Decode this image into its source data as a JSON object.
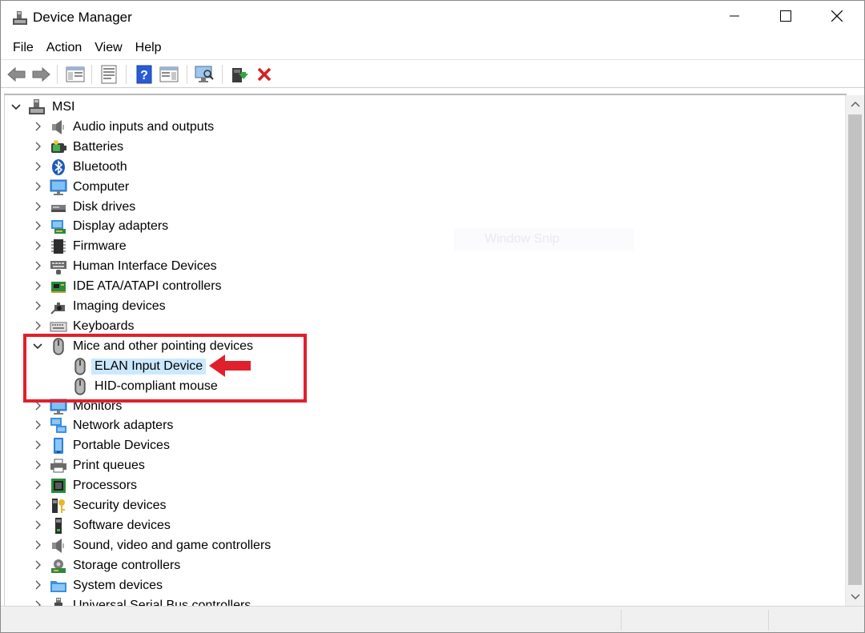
{
  "window": {
    "title": "Device Manager",
    "ghost_text": "Window Snip"
  },
  "menu": [
    {
      "name": "menu-file",
      "label": "File"
    },
    {
      "name": "menu-action",
      "label": "Action"
    },
    {
      "name": "menu-view",
      "label": "View"
    },
    {
      "name": "menu-help",
      "label": "Help"
    }
  ],
  "toolbar_icons": [
    "back-arrow-icon",
    "forward-arrow-icon",
    "show-hide-console-tree-icon",
    "properties-icon",
    "help-icon",
    "action-pane-icon",
    "scan-hardware-icon",
    "update-driver-icon",
    "uninstall-device-icon"
  ],
  "tree": {
    "root": {
      "label": "MSI",
      "icon": "computer-root-icon",
      "expanded": true
    },
    "categories": [
      {
        "label": "Audio inputs and outputs",
        "icon": "speaker-icon"
      },
      {
        "label": "Batteries",
        "icon": "battery-icon"
      },
      {
        "label": "Bluetooth",
        "icon": "bluetooth-icon"
      },
      {
        "label": "Computer",
        "icon": "monitor-icon"
      },
      {
        "label": "Disk drives",
        "icon": "disk-drive-icon"
      },
      {
        "label": "Display adapters",
        "icon": "display-adapter-icon"
      },
      {
        "label": "Firmware",
        "icon": "firmware-chip-icon"
      },
      {
        "label": "Human Interface Devices",
        "icon": "keyboard-hid-icon"
      },
      {
        "label": "IDE ATA/ATAPI controllers",
        "icon": "ide-controller-icon"
      },
      {
        "label": "Imaging devices",
        "icon": "camera-icon"
      },
      {
        "label": "Keyboards",
        "icon": "keyboard-icon"
      },
      {
        "label": "Mice and other pointing devices",
        "icon": "mouse-icon",
        "expanded": true,
        "children": [
          {
            "label": "ELAN Input Device",
            "icon": "mouse-icon",
            "selected": true
          },
          {
            "label": "HID-compliant mouse",
            "icon": "mouse-icon"
          }
        ]
      },
      {
        "label": "Monitors",
        "icon": "monitor-icon"
      },
      {
        "label": "Network adapters",
        "icon": "network-icon"
      },
      {
        "label": "Portable Devices",
        "icon": "portable-device-icon"
      },
      {
        "label": "Print queues",
        "icon": "printer-icon"
      },
      {
        "label": "Processors",
        "icon": "processor-icon"
      },
      {
        "label": "Security devices",
        "icon": "security-key-icon"
      },
      {
        "label": "Software devices",
        "icon": "software-device-icon"
      },
      {
        "label": "Sound, video and game controllers",
        "icon": "speaker-icon"
      },
      {
        "label": "Storage controllers",
        "icon": "storage-controller-icon"
      },
      {
        "label": "System devices",
        "icon": "system-folder-icon"
      },
      {
        "label": "Universal Serial Bus controllers",
        "icon": "usb-icon"
      }
    ]
  },
  "colors": {
    "selection": "#cce8ff",
    "annotation_red": "#e0202c"
  }
}
